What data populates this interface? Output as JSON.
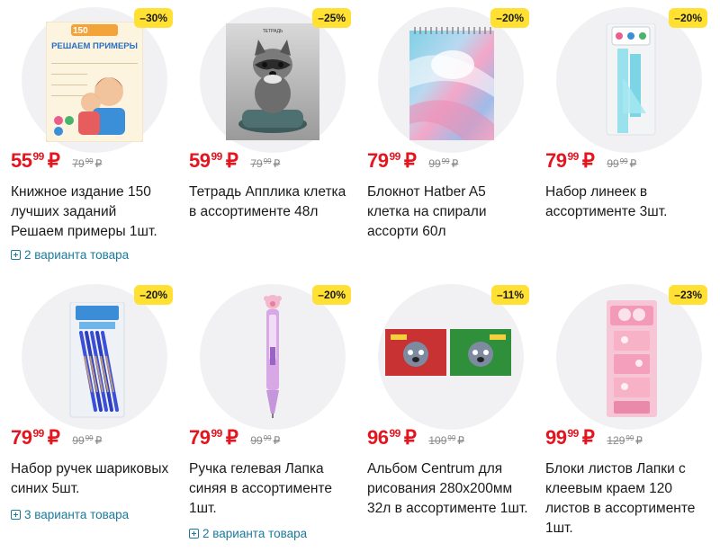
{
  "products": [
    {
      "discount": "–30%",
      "price_int": "55",
      "price_kop": "99",
      "currency": "₽",
      "old_int": "79",
      "old_kop": "99",
      "old_currency": "₽",
      "title": "Книжное издание 150 лучших заданий Решаем примеры 1шт.",
      "variants": "2 варианта товара",
      "image": "book-icon",
      "book_cover": {
        "top": "150",
        "heading": "РЕШАЕМ ПРИМЕРЫ"
      }
    },
    {
      "discount": "–25%",
      "price_int": "59",
      "price_kop": "99",
      "currency": "₽",
      "old_int": "79",
      "old_kop": "99",
      "old_currency": "₽",
      "title": "Тетрадь Апплика клетка в ассортименте 48л",
      "variants": "",
      "image": "notebook-icon",
      "cover_label": "ТЕТРАДЬ"
    },
    {
      "discount": "–20%",
      "price_int": "79",
      "price_kop": "99",
      "currency": "₽",
      "old_int": "99",
      "old_kop": "99",
      "old_currency": "₽",
      "title": "Блокнот Hatber A5 клетка на спирали ассорти 60л",
      "variants": "",
      "image": "spiral-notepad-icon"
    },
    {
      "discount": "–20%",
      "price_int": "79",
      "price_kop": "99",
      "currency": "₽",
      "old_int": "99",
      "old_kop": "99",
      "old_currency": "₽",
      "title": "Набор линеек в ассортименте 3шт.",
      "variants": "",
      "image": "ruler-set-icon"
    },
    {
      "discount": "–20%",
      "price_int": "79",
      "price_kop": "99",
      "currency": "₽",
      "old_int": "99",
      "old_kop": "99",
      "old_currency": "₽",
      "title": "Набор ручек шариковых синих 5шт.",
      "variants": "3 варианта товара",
      "image": "pen-set-icon"
    },
    {
      "discount": "–20%",
      "price_int": "79",
      "price_kop": "99",
      "currency": "₽",
      "old_int": "99",
      "old_kop": "99",
      "old_currency": "₽",
      "title": "Ручка гелевая Лапка синяя в ассортименте 1шт.",
      "variants": "2 варианта товара",
      "image": "gel-pen-icon"
    },
    {
      "discount": "–11%",
      "price_int": "96",
      "price_kop": "99",
      "currency": "₽",
      "old_int": "109",
      "old_kop": "99",
      "old_currency": "₽",
      "title": "Альбом Centrum для рисования 280x200мм 32л в ассортименте 1шт.",
      "variants": "",
      "image": "drawing-album-icon"
    },
    {
      "discount": "–23%",
      "price_int": "99",
      "price_kop": "99",
      "currency": "₽",
      "old_int": "129",
      "old_kop": "99",
      "old_currency": "₽",
      "title": "Блоки листов Лапки с клеевым краем 120 листов в ассортименте 1шт.",
      "variants": "",
      "image": "sticky-notes-icon"
    }
  ],
  "colors": {
    "price": "#e4151f",
    "badge": "#ffe033",
    "link": "#1a7a9c",
    "circle": "#f1f1f3"
  }
}
